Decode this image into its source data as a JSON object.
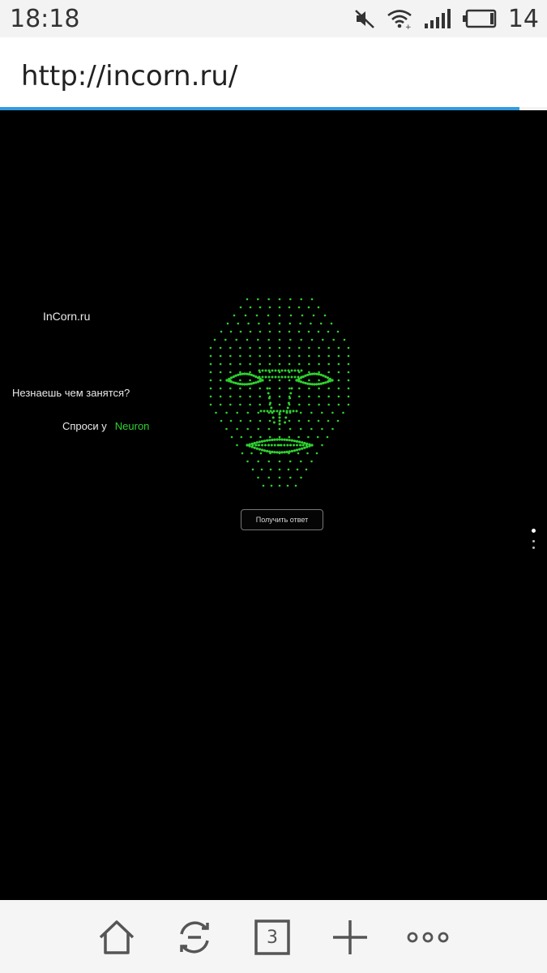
{
  "status_bar": {
    "time": "18:18",
    "battery_level": "14",
    "icons": [
      "mute-icon",
      "wifi-icon",
      "signal-icon",
      "battery-icon"
    ]
  },
  "browser": {
    "url": "http://incorn.ru/",
    "load_progress": 0.95,
    "tab_count": "3",
    "toolbar_icons": [
      "home-icon",
      "refresh-icon",
      "tabs-icon",
      "new-tab-icon",
      "more-icon"
    ],
    "accent_color": "#2f9be0"
  },
  "page": {
    "site_title": "InCorn.ru",
    "question": "Незнаешь чем занятся?",
    "ask_prefix": "Спроси у",
    "ask_name": "Neuron",
    "answer_button": "Получить ответ",
    "face_color": "#2fd12f",
    "background": "#000000"
  }
}
